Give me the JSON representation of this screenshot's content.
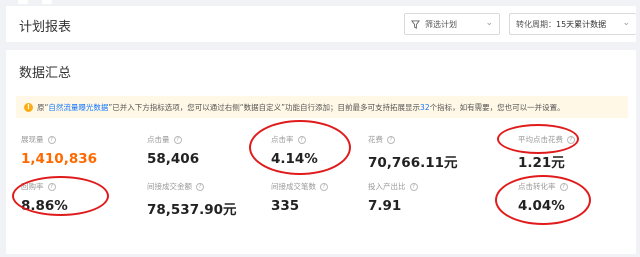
{
  "header": {
    "title": "计划报表",
    "filter_plan_label": "筛选计划",
    "period_prefix": "转化周期：",
    "period_value": "15天累计数据"
  },
  "summary": {
    "title": "数据汇总",
    "notice": {
      "prefix": "原“",
      "link": "自然流量曝光数据",
      "middle": "”已并入下方指标选项，您可以通过右侧“数据自定义”功能自行添加；目前最多可支持拓展显示",
      "count": "32",
      "suffix": "个指标，如有需要，您也可以一并设置。"
    },
    "metrics": [
      {
        "label": "展现量",
        "value": "1,410,836"
      },
      {
        "label": "点击量",
        "value": "58,406"
      },
      {
        "label": "点击率",
        "value": "4.14%"
      },
      {
        "label": "花费",
        "value": "70,766.11元"
      },
      {
        "label": "平均点击花费",
        "value": "1.21元"
      },
      {
        "label": "回购率",
        "value": "8.86%"
      },
      {
        "label": "间接成交金额",
        "value": "78,537.90元"
      },
      {
        "label": "间接成交笔数",
        "value": "335"
      },
      {
        "label": "投入产出比",
        "value": "7.91"
      },
      {
        "label": "点击转化率",
        "value": "4.04%"
      }
    ]
  },
  "colors": {
    "accent": "#ff6a00",
    "link": "#1677ff",
    "annotation": "#e01b1b",
    "notice_bg": "#fff8e6"
  }
}
